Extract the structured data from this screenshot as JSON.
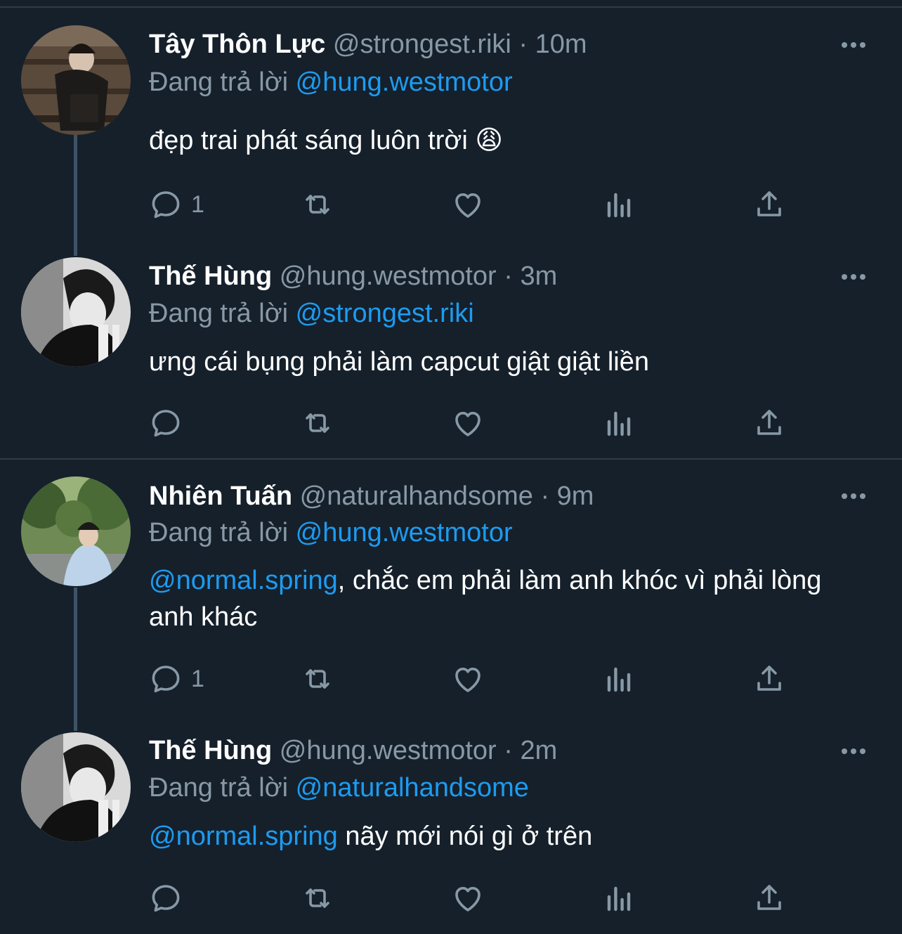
{
  "tweets": [
    {
      "name": "Tây Thôn Lực",
      "handle": "@strongest.riki",
      "sep": "·",
      "time": "10m",
      "reply_prefix": "Đang trả lời",
      "reply_to": "@hung.westmotor",
      "text": "đẹp trai phát sáng luôn trời",
      "emoji": "😩",
      "reply_count": "1"
    },
    {
      "name": "Thế Hùng",
      "handle": "@hung.westmotor",
      "sep": "·",
      "time": "3m",
      "reply_prefix": "Đang trả lời",
      "reply_to": "@strongest.riki",
      "text": "ưng cái bụng phải làm capcut giật giật liền",
      "reply_count": ""
    },
    {
      "name": "Nhiên Tuấn",
      "handle": "@naturalhandsome",
      "sep": "·",
      "time": "9m",
      "reply_prefix": "Đang trả lời",
      "reply_to": "@hung.westmotor",
      "mention": "@normal.spring",
      "text": ", chắc em phải làm anh khóc vì phải lòng anh khác",
      "reply_count": "1"
    },
    {
      "name": "Thế Hùng",
      "handle": "@hung.westmotor",
      "sep": "·",
      "time": "2m",
      "reply_prefix": "Đang trả lời",
      "reply_to": "@naturalhandsome",
      "mention": "@normal.spring",
      "text": " nãy mới nói gì ở trên",
      "reply_count": ""
    }
  ],
  "icons": {
    "more": "more-icon",
    "reply": "reply-icon",
    "retweet": "retweet-icon",
    "like": "heart-icon",
    "views": "views-icon",
    "share": "share-icon"
  },
  "colors": {
    "background": "#15202b",
    "link": "#1d9bf0",
    "muted": "#8899a6",
    "thread_line": "#3d5466"
  }
}
